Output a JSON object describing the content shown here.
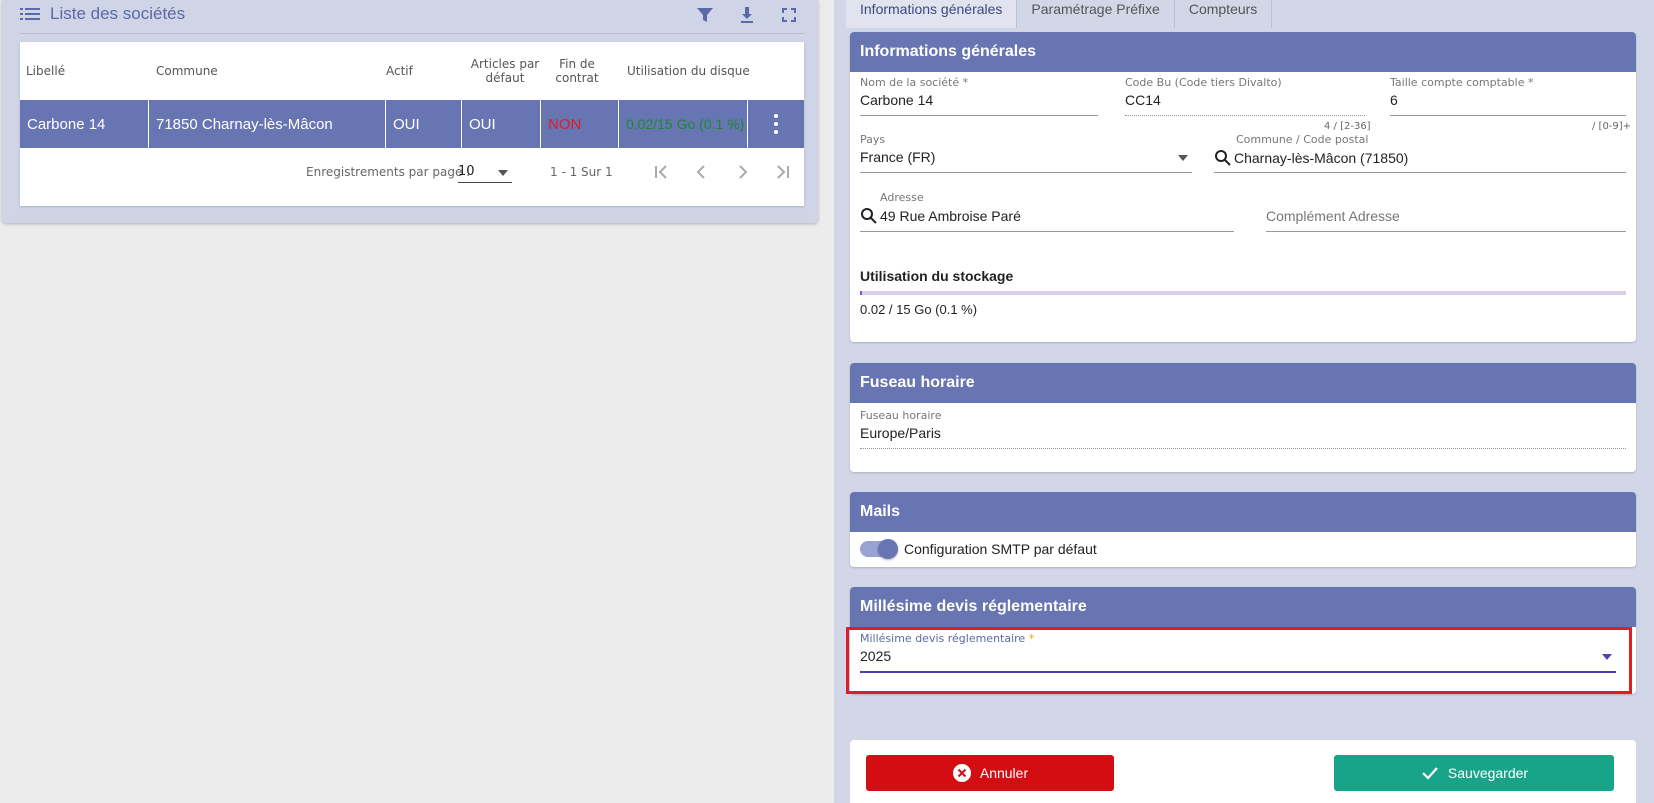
{
  "left": {
    "title": "Liste des sociétés",
    "columns": [
      "Libellé",
      "Commune",
      "Actif",
      "Articles par défaut",
      "Fin de contrat",
      "Utilisation du disque"
    ],
    "row": {
      "libelle": "Carbone 14",
      "commune": "71850 Charnay-lès-Mâcon",
      "actif": "OUI",
      "articles": "OUI",
      "fin": "NON",
      "disque": "0.02/15 Go (0.1 %)"
    },
    "pager": {
      "label": "Enregistrements par page :",
      "per_page": "10",
      "range": "1 - 1 Sur 1"
    }
  },
  "tabs": [
    "Informations générales",
    "Paramétrage Préfixe",
    "Compteurs"
  ],
  "info": {
    "title": "Informations générales",
    "nom_label": "Nom de la société *",
    "nom_value": "Carbone 14",
    "code_label": "Code Bu (Code tiers Divalto)",
    "code_value": "CC14",
    "code_hint": "4 / [2-36]",
    "taille_label": "Taille compte comptable *",
    "taille_value": "6",
    "taille_hint": "/ [0-9]+",
    "pays_label": "Pays",
    "pays_value": "France (FR)",
    "commune_label": "Commune / Code postal",
    "commune_value": "Charnay-lès-Mâcon (71850)",
    "adresse_label": "Adresse",
    "adresse_value": "49 Rue Ambroise Paré",
    "complement_placeholder": "Complément Adresse",
    "storage_title": "Utilisation du stockage",
    "storage_value": "0.02 / 15 Go (0.1 %)",
    "storage_fraction": 0.001
  },
  "fuseau": {
    "title": "Fuseau horaire",
    "label": "Fuseau horaire",
    "value": "Europe/Paris"
  },
  "mails": {
    "title": "Mails",
    "toggle_label": "Configuration SMTP par défaut",
    "toggle_on": true
  },
  "millesime": {
    "title": "Millésime devis réglementaire",
    "label": "Millésime devis réglementaire",
    "required_mark": "*",
    "value": "2025"
  },
  "actions": {
    "cancel": "Annuler",
    "save": "Sauvegarder"
  },
  "colors": {
    "header": "#6775b2",
    "danger": "#d40d12",
    "success": "#17a488",
    "highlight": "#e31b23"
  }
}
